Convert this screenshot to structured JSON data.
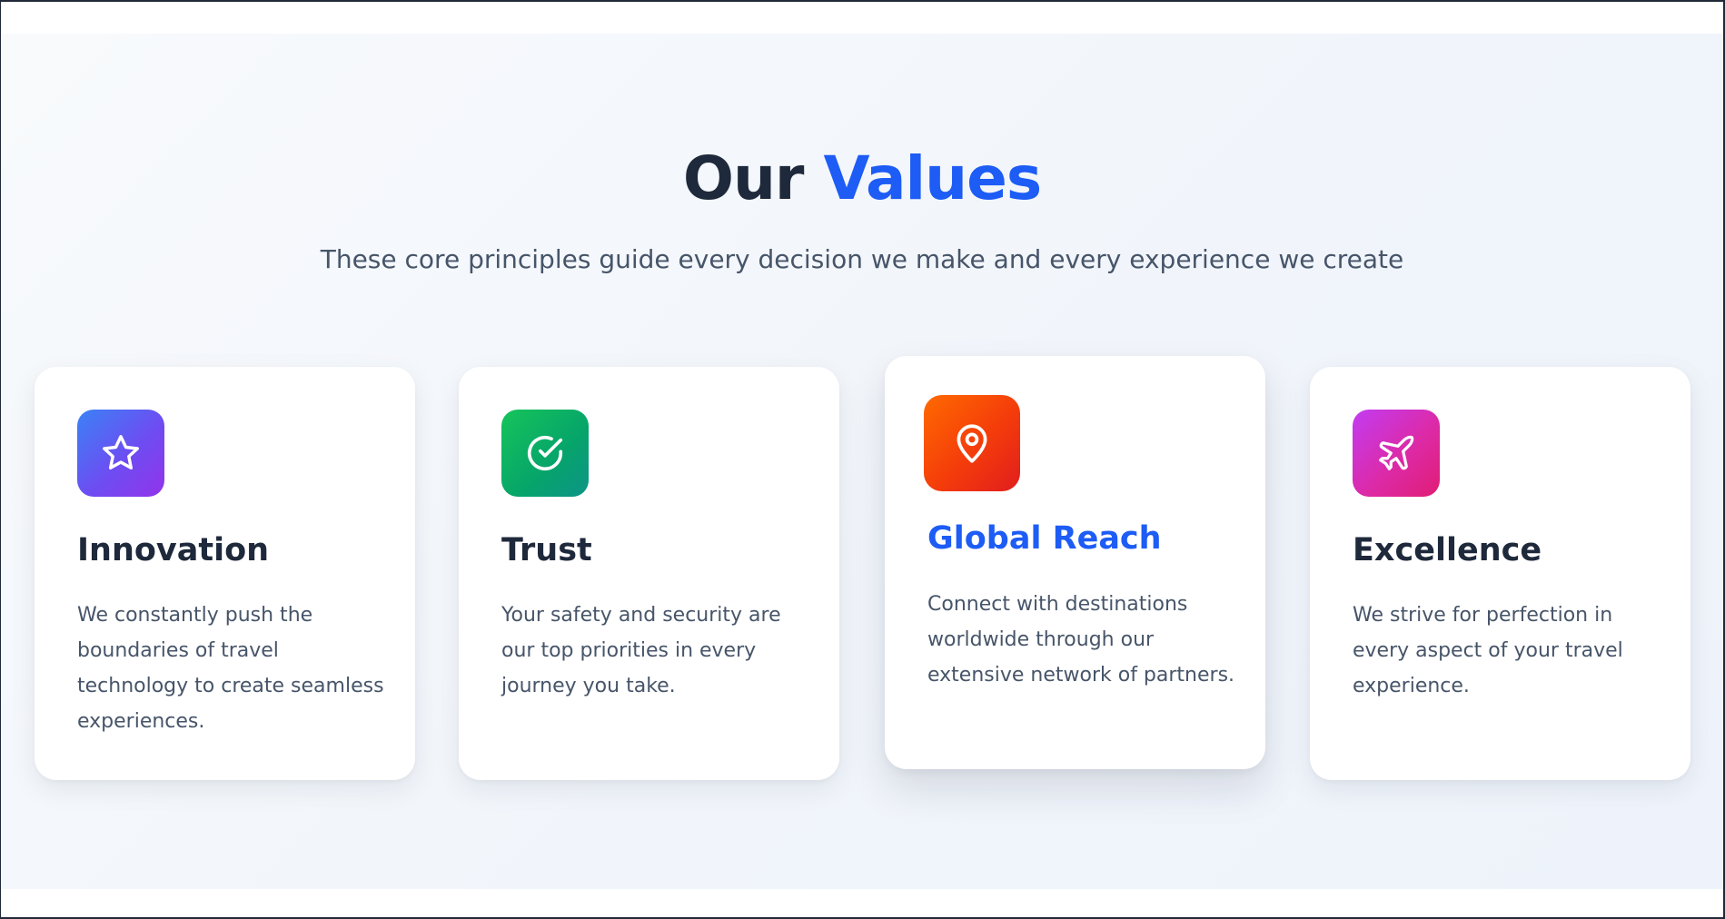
{
  "section": {
    "title_main": "Our",
    "title_accent": "Values",
    "subtitle": "These core principles guide every decision we make and every experience we create"
  },
  "colors": {
    "accent": "#1d5cf5",
    "heading": "#1e293b",
    "body_text": "#475569"
  },
  "values": [
    {
      "title": "Innovation",
      "description": "We constantly push the boundaries of travel technology to create seamless experiences.",
      "icon": "star-icon",
      "gradient": [
        "#3b82f6",
        "#9333ea"
      ]
    },
    {
      "title": "Trust",
      "description": "Your safety and security are our top priorities in every journey you take.",
      "icon": "check-circle-icon",
      "gradient": [
        "#16c45a",
        "#0d9488"
      ]
    },
    {
      "title": "Global Reach",
      "description": "Connect with destinations worldwide through our extensive network of partners.",
      "icon": "map-pin-icon",
      "gradient": [
        "#ff6a00",
        "#e11d1d"
      ],
      "highlighted": true
    },
    {
      "title": "Excellence",
      "description": "We strive for perfection in every aspect of your travel experience.",
      "icon": "plane-icon",
      "gradient": [
        "#c23cf2",
        "#e11d74"
      ]
    }
  ]
}
